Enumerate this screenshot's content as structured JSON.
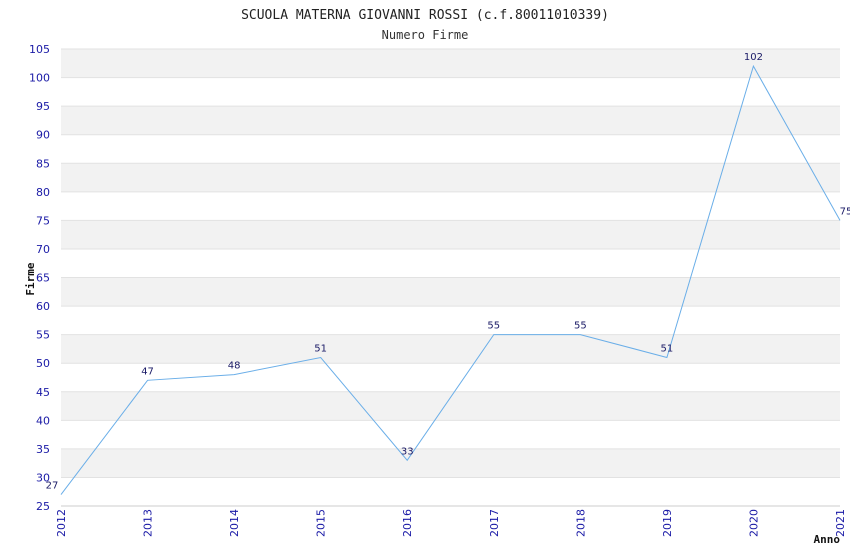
{
  "chart_data": {
    "type": "line",
    "title": "SCUOLA MATERNA GIOVANNI ROSSI (c.f.80011010339)",
    "subtitle": "Numero Firme",
    "xlabel": "Anno",
    "ylabel": "Firme",
    "categories": [
      "2012",
      "2013",
      "2014",
      "2015",
      "2016",
      "2017",
      "2018",
      "2019",
      "2020",
      "2021"
    ],
    "series": [
      {
        "values": [
          27,
          47,
          48,
          51,
          33,
          55,
          55,
          51,
          102,
          75
        ]
      }
    ],
    "data_labels": [
      "27",
      "47",
      "48",
      "51",
      "33",
      "55",
      "55",
      "51",
      "102",
      "75"
    ],
    "ylim": [
      25,
      105
    ],
    "yticks": [
      "25",
      "30",
      "35",
      "40",
      "45",
      "50",
      "55",
      "60",
      "65",
      "70",
      "75",
      "80",
      "85",
      "90",
      "95",
      "100",
      "105"
    ],
    "grid": true,
    "line_color": "#6aaee8",
    "band_color": "#f2f2f2",
    "tick_color": "#1a1aa6"
  }
}
